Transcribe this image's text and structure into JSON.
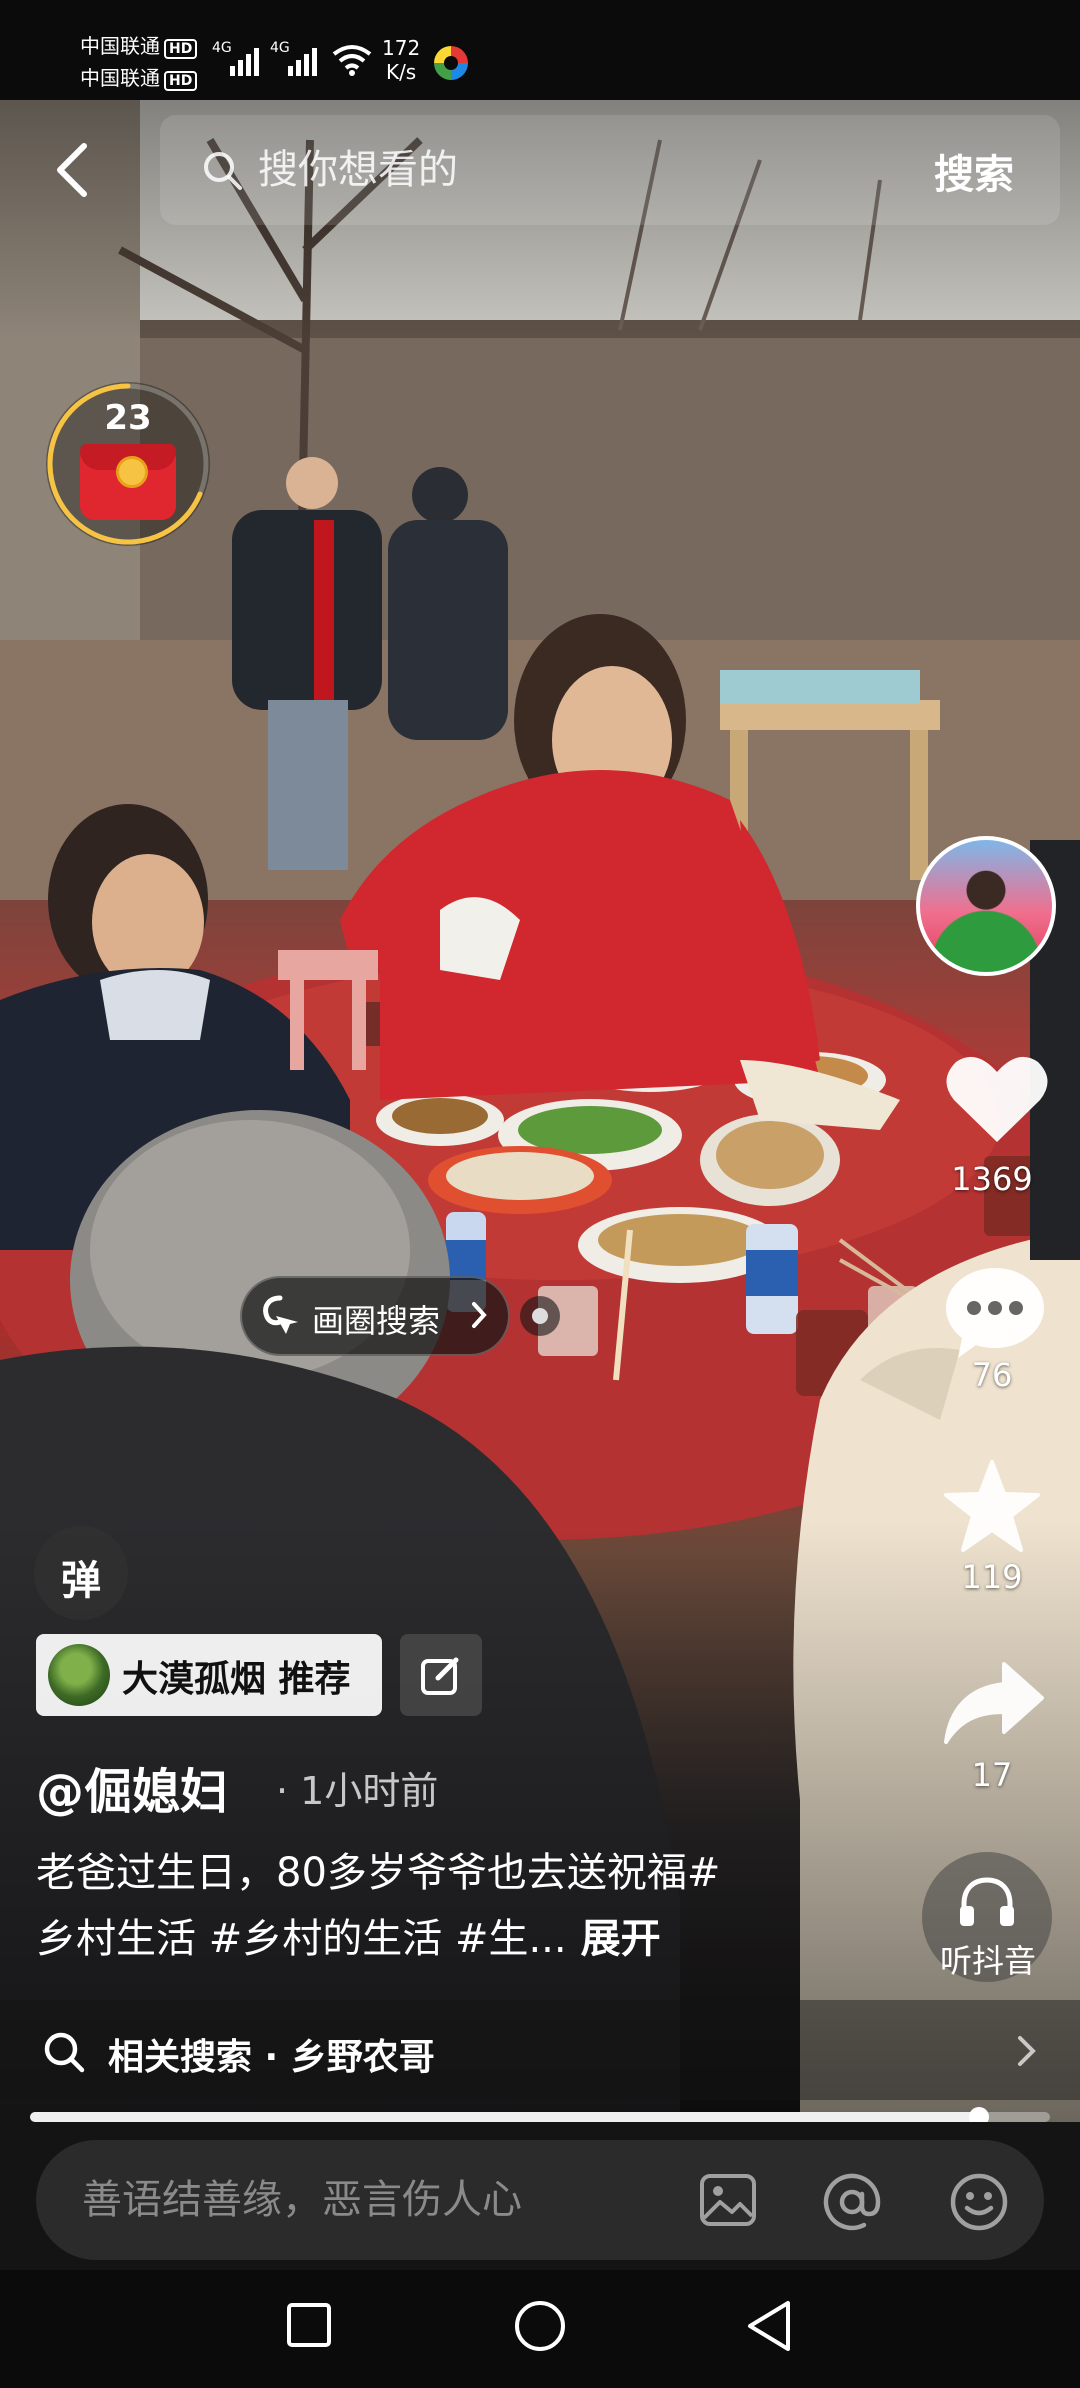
{
  "status_bar": {
    "carrier_1": "中国联通",
    "carrier_2": "中国联通",
    "hd_badge": "HD",
    "network_1": "4G",
    "network_2": "4G",
    "speed_value": "172",
    "speed_unit": "K/s"
  },
  "search": {
    "placeholder": "搜你想看的",
    "button_label": "搜索"
  },
  "red_packet": {
    "count": "23"
  },
  "right_rail": {
    "like_count": "1369",
    "comment_count": "76",
    "favorite_count": "119",
    "share_count": "17",
    "listen_label": "听抖音"
  },
  "circle_search": {
    "label": "画圈搜索"
  },
  "danmu": {
    "label": "弹"
  },
  "topic": {
    "label": "大漠孤烟 推荐"
  },
  "post": {
    "author": "@倔媳妇",
    "time_ago": "· 1小时前",
    "caption_line1": "老爸过生日，80多岁爷爷也去送祝福#",
    "caption_line2": "乡村生活 #乡村的生活 #生...",
    "expand_label": "展开"
  },
  "related_search": {
    "label": "相关搜索 · 乡野农哥"
  },
  "playback": {
    "progress_fraction": 0.93
  },
  "comment_bar": {
    "placeholder": "善语结善缘，恶言伤人心"
  },
  "icons": {
    "back": "chevron-left-icon",
    "search": "search-icon",
    "like": "heart-icon",
    "comment": "speech-bubble-icon",
    "favorite": "star-icon",
    "share": "share-arrow-icon",
    "listen": "headphones-icon",
    "edit": "edit-icon",
    "image": "image-icon",
    "mention": "at-icon",
    "emoji": "smiley-icon",
    "nav_recent": "square-icon",
    "nav_home": "circle-icon",
    "nav_back": "triangle-back-icon"
  },
  "colors": {
    "like_heart": "#ffffff",
    "red_packet": "#e0262f",
    "packet_ring": "#f6c343",
    "background": "#000000"
  }
}
